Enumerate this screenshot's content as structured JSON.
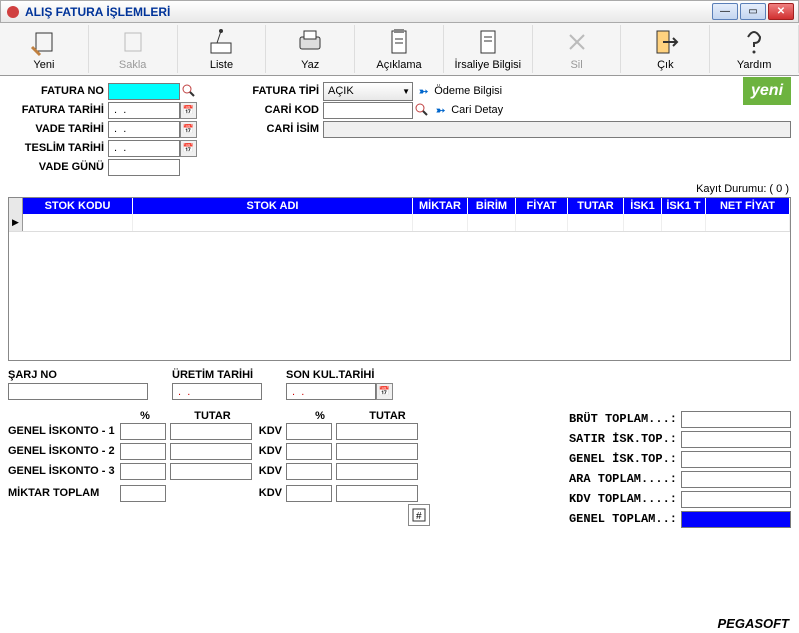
{
  "window": {
    "title": "ALIŞ FATURA İŞLEMLERİ"
  },
  "toolbar": {
    "yeni": "Yeni",
    "sakla": "Sakla",
    "liste": "Liste",
    "yaz": "Yaz",
    "aciklama": "Açıklama",
    "irsaliye": "İrsaliye Bilgisi",
    "sil": "Sil",
    "cik": "Çık",
    "yardim": "Yardım"
  },
  "form": {
    "fatura_no_lbl": "FATURA NO",
    "fatura_no": "",
    "fatura_tarihi_lbl": "FATURA TARİHİ",
    "fatura_tarihi": " .  . ",
    "vade_tarihi_lbl": "VADE TARİHİ",
    "vade_tarihi": " .  . ",
    "teslim_tarihi_lbl": "TESLİM TARİHİ",
    "teslim_tarihi": " .  . ",
    "vade_gunu_lbl": "VADE GÜNÜ",
    "vade_gunu": "",
    "fatura_tipi_lbl": "FATURA TİPİ",
    "fatura_tipi": "AÇIK",
    "odeme_bilgisi": "Ödeme Bilgisi",
    "cari_kod_lbl": "CARİ KOD",
    "cari_kod": "",
    "cari_detay": "Cari Detay",
    "cari_isim_lbl": "CARİ İSİM",
    "cari_isim": "",
    "yeni_badge": "yeni",
    "kayit_durumu": "Kayıt Durumu: ( 0 )"
  },
  "grid": {
    "cols": [
      "STOK KODU",
      "STOK ADI",
      "MİKTAR",
      "BİRİM",
      "FİYAT",
      "TUTAR",
      "İSK1",
      "İSK1 T",
      "NET FİYAT"
    ]
  },
  "batch": {
    "sarj_no_lbl": "ŞARJ NO",
    "sarj_no": "",
    "uretim_lbl": "ÜRETİM TARİHİ",
    "uretim": " .  . ",
    "skt_lbl": "SON KUL.TARİHİ",
    "skt": " .  . "
  },
  "ltot": {
    "hdr_pct": "%",
    "hdr_tutar": "TUTAR",
    "g1": "GENEL İSKONTO - 1",
    "g2": "GENEL İSKONTO - 2",
    "g3": "GENEL İSKONTO - 3",
    "miktar": "MİKTAR TOPLAM",
    "kdv": "KDV"
  },
  "rtot": {
    "brut": "BRÜT TOPLAM...:",
    "satir": "SATIR İSK.TOP.:",
    "genel": "GENEL İSK.TOP.:",
    "ara": "ARA TOPLAM....:",
    "kdv": "KDV TOPLAM....:",
    "gtop": "GENEL TOPLAM..:"
  },
  "footer": "PEGASOFT"
}
